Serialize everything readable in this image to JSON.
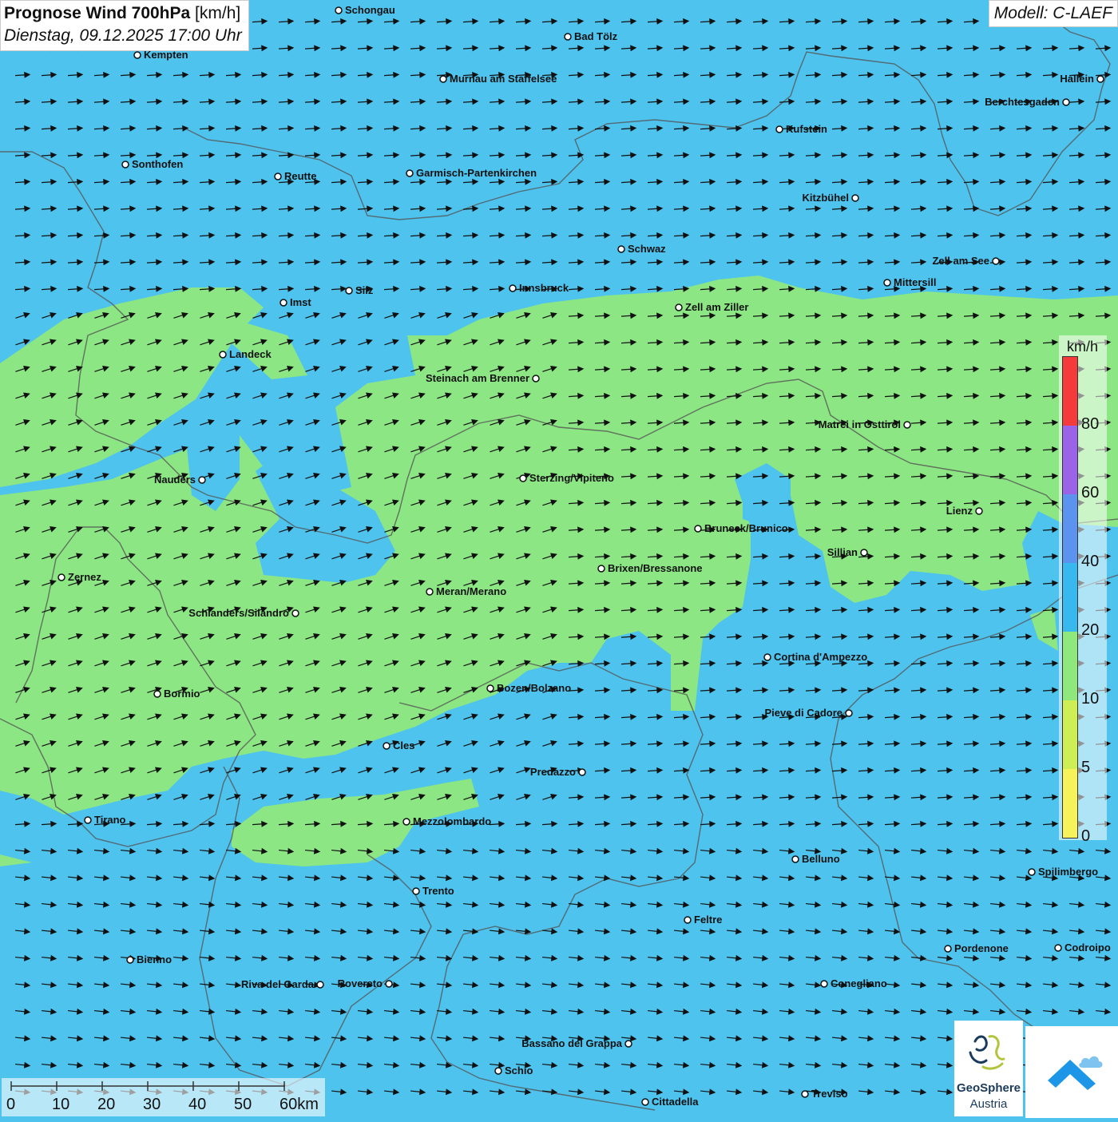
{
  "header": {
    "title": "Prognose Wind 700hPa",
    "unit": "[km/h]",
    "datetime": "Dienstag, 09.12.2025 17:00 Uhr",
    "model": "Modell: C-LAEF"
  },
  "legend": {
    "unit": "km/h",
    "ticks": [
      "80",
      "60",
      "40",
      "20",
      "10",
      "5",
      "0"
    ],
    "colors": [
      "#f43a3a",
      "#9b63e8",
      "#5b93ee",
      "#37b9ef",
      "#8fe87c",
      "#cdef55",
      "#f5f25a"
    ]
  },
  "scale": {
    "labels": [
      "0",
      "10",
      "20",
      "30",
      "40",
      "50",
      "60km"
    ]
  },
  "logos": {
    "geosphere_line1": "GeoSphere",
    "geosphere_line2": "Austria"
  },
  "colors": {
    "water_low": "#4ec3ee",
    "wind_10_20": "#8fe87c",
    "border": "#555555"
  },
  "cities": [
    {
      "name": "Schongau"
    },
    {
      "name": "Bad Tölz"
    },
    {
      "name": "Kempten"
    },
    {
      "name": "Murnau am Staffelsee"
    },
    {
      "name": "Hallein"
    },
    {
      "name": "Berchtesgaden"
    },
    {
      "name": "Kufstein"
    },
    {
      "name": "Sonthofen"
    },
    {
      "name": "Reutte"
    },
    {
      "name": "Garmisch-Partenkirchen"
    },
    {
      "name": "Kitzbühel"
    },
    {
      "name": "Schwaz"
    },
    {
      "name": "Zell am See"
    },
    {
      "name": "Mittersill"
    },
    {
      "name": "Imst"
    },
    {
      "name": "Silz"
    },
    {
      "name": "Innsbruck"
    },
    {
      "name": "Zell am Ziller"
    },
    {
      "name": "Landeck"
    },
    {
      "name": "Steinach am Brenner"
    },
    {
      "name": "Matrei in Osttirol"
    },
    {
      "name": "Nauders"
    },
    {
      "name": "Sterzing/Vipiteno"
    },
    {
      "name": "Lienz"
    },
    {
      "name": "Bruneck/Brunico"
    },
    {
      "name": "Sillian"
    },
    {
      "name": "Zernez"
    },
    {
      "name": "Brixen/Bressanone"
    },
    {
      "name": "Meran/Merano"
    },
    {
      "name": "Schlanders/Silandro"
    },
    {
      "name": "Cortina d'Ampezzo"
    },
    {
      "name": "Bozen/Bolzano"
    },
    {
      "name": "Bormio"
    },
    {
      "name": "Pieve di Cadore"
    },
    {
      "name": "Cles"
    },
    {
      "name": "Predazzo"
    },
    {
      "name": "Tirano"
    },
    {
      "name": "Mezzolombardo"
    },
    {
      "name": "Belluno"
    },
    {
      "name": "Spilimbergo"
    },
    {
      "name": "Trento"
    },
    {
      "name": "Feltre"
    },
    {
      "name": "Pordenone"
    },
    {
      "name": "Codroipo"
    },
    {
      "name": "Bienno"
    },
    {
      "name": "Riva del Garda"
    },
    {
      "name": "Rovereto"
    },
    {
      "name": "Conegliano"
    },
    {
      "name": "Bassano del Grappa"
    },
    {
      "name": "Schio"
    },
    {
      "name": "Treviso"
    },
    {
      "name": "Cittadella"
    }
  ]
}
